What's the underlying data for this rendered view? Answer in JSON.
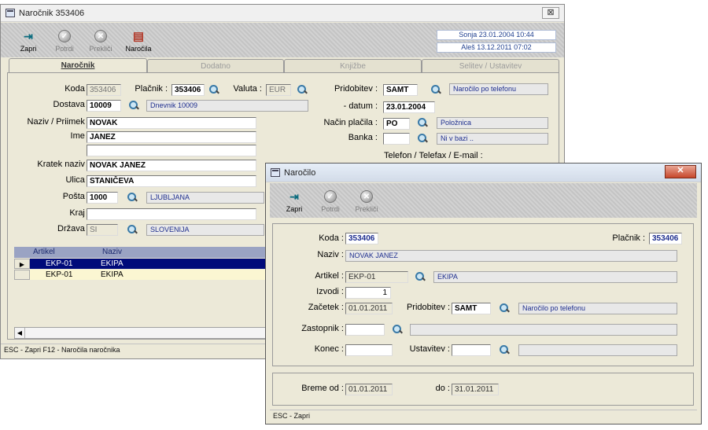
{
  "main": {
    "title": "Naročnik 353406",
    "close_label": "⊠",
    "toolbar": [
      {
        "label": "Zapri",
        "icon": "exit-icon",
        "enabled": true
      },
      {
        "label": "Potrdi",
        "icon": "check-icon",
        "enabled": false
      },
      {
        "label": "Prekliči",
        "icon": "cancel-icon",
        "enabled": false
      },
      {
        "label": "Naročila",
        "icon": "orders-icon",
        "enabled": true
      }
    ],
    "stamps": [
      "Sonja  23.01.2004 10:44",
      "Aleš  13.12.2011 07:02"
    ],
    "tabs": [
      "Naročnik",
      "Dodatno",
      "Knjižbe",
      "Selitev / Ustavitev"
    ],
    "form": {
      "koda_label": "Koda :",
      "koda": "353406",
      "placnik_label": "Plačnik :",
      "placnik": "353406",
      "valuta_label": "Valuta :",
      "valuta": "EUR",
      "dostava_label": "Dostava :",
      "dostava": "10009",
      "dostava_info": "Dnevnik 10009",
      "naziv_label": "Naziv / Priimek :",
      "naziv": "NOVAK",
      "ime_label": "Ime :",
      "ime": "JANEZ",
      "kratek_label": "Kratek naziv :",
      "kratek": "NOVAK JANEZ",
      "ulica_label": "Ulica :",
      "ulica": "STANIČEVA",
      "posta_label": "Pošta :",
      "posta": "1000",
      "posta_info": "LJUBLJANA",
      "kraj_label": "Kraj :",
      "drzava_label": "Država :",
      "drzava": "SI",
      "drzava_info": "SLOVENIJA",
      "pridobitev_label": "Pridobitev :",
      "pridobitev": "SAMT",
      "pridobitev_info": "Naročilo po telefonu",
      "datum_label": "- datum :",
      "datum": "23.01.2004",
      "nacin_label": "Način plačila :",
      "nacin": "PO",
      "nacin_info": "Položnica",
      "banka_label": "Banka :",
      "banka_info": "Ni v bazi ..",
      "telefon_label": "Telefon / Telefax / E-mail :"
    },
    "grid": {
      "columns": [
        "Artikel",
        "Naziv"
      ],
      "rows": [
        [
          "EKP-01",
          "EKIPA"
        ],
        [
          "EKP-01",
          "EKIPA"
        ]
      ]
    },
    "status": "ESC - Zapri   F12 - Naročila naročnika"
  },
  "dialog": {
    "title": "Naročilo",
    "close_label": "✕",
    "toolbar": [
      {
        "label": "Zapri",
        "icon": "exit-icon",
        "enabled": true
      },
      {
        "label": "Potrdi",
        "icon": "check-icon",
        "enabled": false
      },
      {
        "label": "Prekliči",
        "icon": "cancel-icon",
        "enabled": false
      }
    ],
    "koda_label": "Koda :",
    "koda": "353406",
    "placnik_label": "Plačnik :",
    "placnik": "353406",
    "naziv_label": "Naziv :",
    "naziv": "NOVAK JANEZ",
    "artikel_label": "Artikel :",
    "artikel": "EKP-01",
    "artikel_info": "EKIPA",
    "izvodi_label": "Izvodi :",
    "izvodi": "1",
    "zacetek_label": "Začetek :",
    "zacetek": "01.01.2011",
    "pridobitev_label": "Pridobitev :",
    "pridobitev": "SAMT",
    "pridobitev_info": "Naročilo po telefonu",
    "zastopnik_label": "Zastopnik :",
    "konec_label": "Konec :",
    "ustavitev_label": "Ustavitev :",
    "breme_od_label": "Breme od :",
    "breme_od": "01.01.2011",
    "do_label": "do :",
    "do": "31.01.2011",
    "status": "ESC - Zapri"
  }
}
